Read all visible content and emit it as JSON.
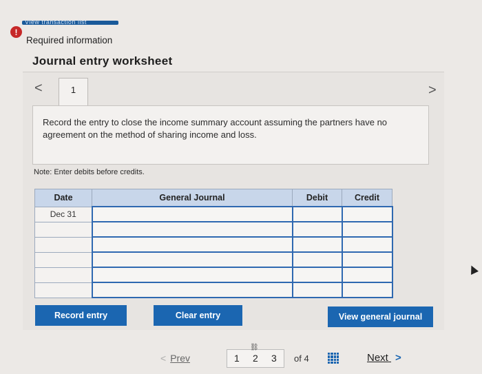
{
  "banner": {
    "text": "View transaction list"
  },
  "alert": {
    "icon": "alert-icon",
    "symbol": "!"
  },
  "required_info": "Required information",
  "title": "Journal entry worksheet",
  "nav": {
    "prev_symbol": "<",
    "next_symbol": ">",
    "current_tab": "1"
  },
  "instruction": "Record the entry to close the income summary account assuming the partners have no agreement on the method of sharing income and loss.",
  "note": "Note: Enter debits before credits.",
  "table": {
    "headers": {
      "date": "Date",
      "journal": "General Journal",
      "debit": "Debit",
      "credit": "Credit"
    },
    "rows": [
      {
        "date": "Dec 31",
        "account": "",
        "debit": "",
        "credit": ""
      },
      {
        "date": "",
        "account": "",
        "debit": "",
        "credit": ""
      },
      {
        "date": "",
        "account": "",
        "debit": "",
        "credit": ""
      },
      {
        "date": "",
        "account": "",
        "debit": "",
        "credit": ""
      },
      {
        "date": "",
        "account": "",
        "debit": "",
        "credit": ""
      },
      {
        "date": "",
        "account": "",
        "debit": "",
        "credit": ""
      }
    ]
  },
  "buttons": {
    "record": "Record entry",
    "clear": "Clear entry",
    "view": "View general journal"
  },
  "pager": {
    "prev": "Prev",
    "pages": [
      "1",
      "2",
      "3"
    ],
    "of": "of 4",
    "next": "Next",
    "next_symbol": ">",
    "prev_symbol": "<"
  },
  "colors": {
    "accent": "#1b66b1",
    "header_bg": "#c8d6ea",
    "alert": "#c62828"
  }
}
